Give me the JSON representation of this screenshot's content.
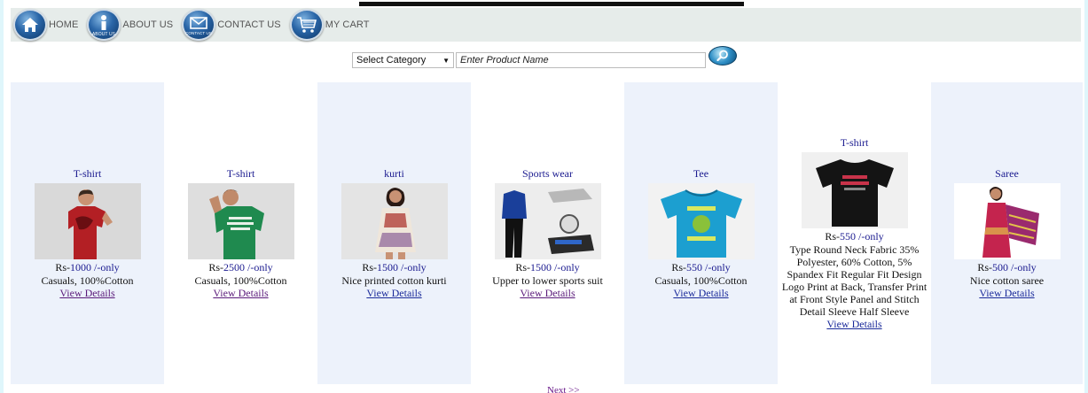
{
  "nav": {
    "items": [
      {
        "label": "HOME",
        "icon": "home-icon"
      },
      {
        "label": "ABOUT US",
        "icon": "info-icon"
      },
      {
        "label": "CONTACT US",
        "icon": "envelope-icon"
      },
      {
        "label": "MY CART",
        "icon": "cart-icon"
      }
    ],
    "about_badge": "About us",
    "contact_badge": "Contact Us"
  },
  "search": {
    "category_selected": "Select Category",
    "product_placeholder": "Enter Product Name"
  },
  "products": [
    {
      "title": "T-shirt",
      "price_prefix": "Rs-",
      "price": "1000",
      "price_suffix": " /-only",
      "desc": "Casuals, 100%Cotton",
      "link": "View Details",
      "image": "red-tshirt-photo"
    },
    {
      "title": "T-shirt",
      "price_prefix": "Rs-",
      "price": "2500",
      "price_suffix": " /-only",
      "desc": "Casuals, 100%Cotton",
      "link": "View Details",
      "image": "green-tshirt-photo"
    },
    {
      "title": "kurti",
      "price_prefix": "Rs-",
      "price": "1500",
      "price_suffix": " /-only",
      "desc": "Nice printed cotton kurti",
      "link": "View Details",
      "image": "kurti-photo"
    },
    {
      "title": "Sports wear",
      "price_prefix": "Rs-",
      "price": "1500",
      "price_suffix": " /-only",
      "desc": "Upper to lower sports suit",
      "link": "View Details",
      "image": "sportswear-photo"
    },
    {
      "title": "Tee",
      "price_prefix": "Rs-",
      "price": "550",
      "price_suffix": " /-only",
      "desc": "Casuals, 100%Cotton",
      "link": "View Details",
      "image": "blue-tee-photo"
    },
    {
      "title": "T-shirt",
      "price_prefix": "Rs-",
      "price": "550",
      "price_suffix": " /-only",
      "desc": "Type Round Neck Fabric 35% Polyester, 60% Cotton, 5% Spandex Fit Regular Fit Design Logo Print at Back, Transfer Print at Front Style Panel and Stitch Detail Sleeve Half Sleeve",
      "link": "View Details",
      "image": "black-tshirt-photo"
    },
    {
      "title": "Saree",
      "price_prefix": "Rs-",
      "price": "500",
      "price_suffix": " /-only",
      "desc": "Nice cotton saree",
      "link": "View Details",
      "image": "saree-photo"
    }
  ],
  "pagination": {
    "next_label": "Next >>"
  },
  "colors": {
    "link_blue": "#1a2a9a",
    "link_visited": "#5a1a7a",
    "card_alt_bg": "#edf2fb",
    "nav_bg": "#e6ecea"
  }
}
